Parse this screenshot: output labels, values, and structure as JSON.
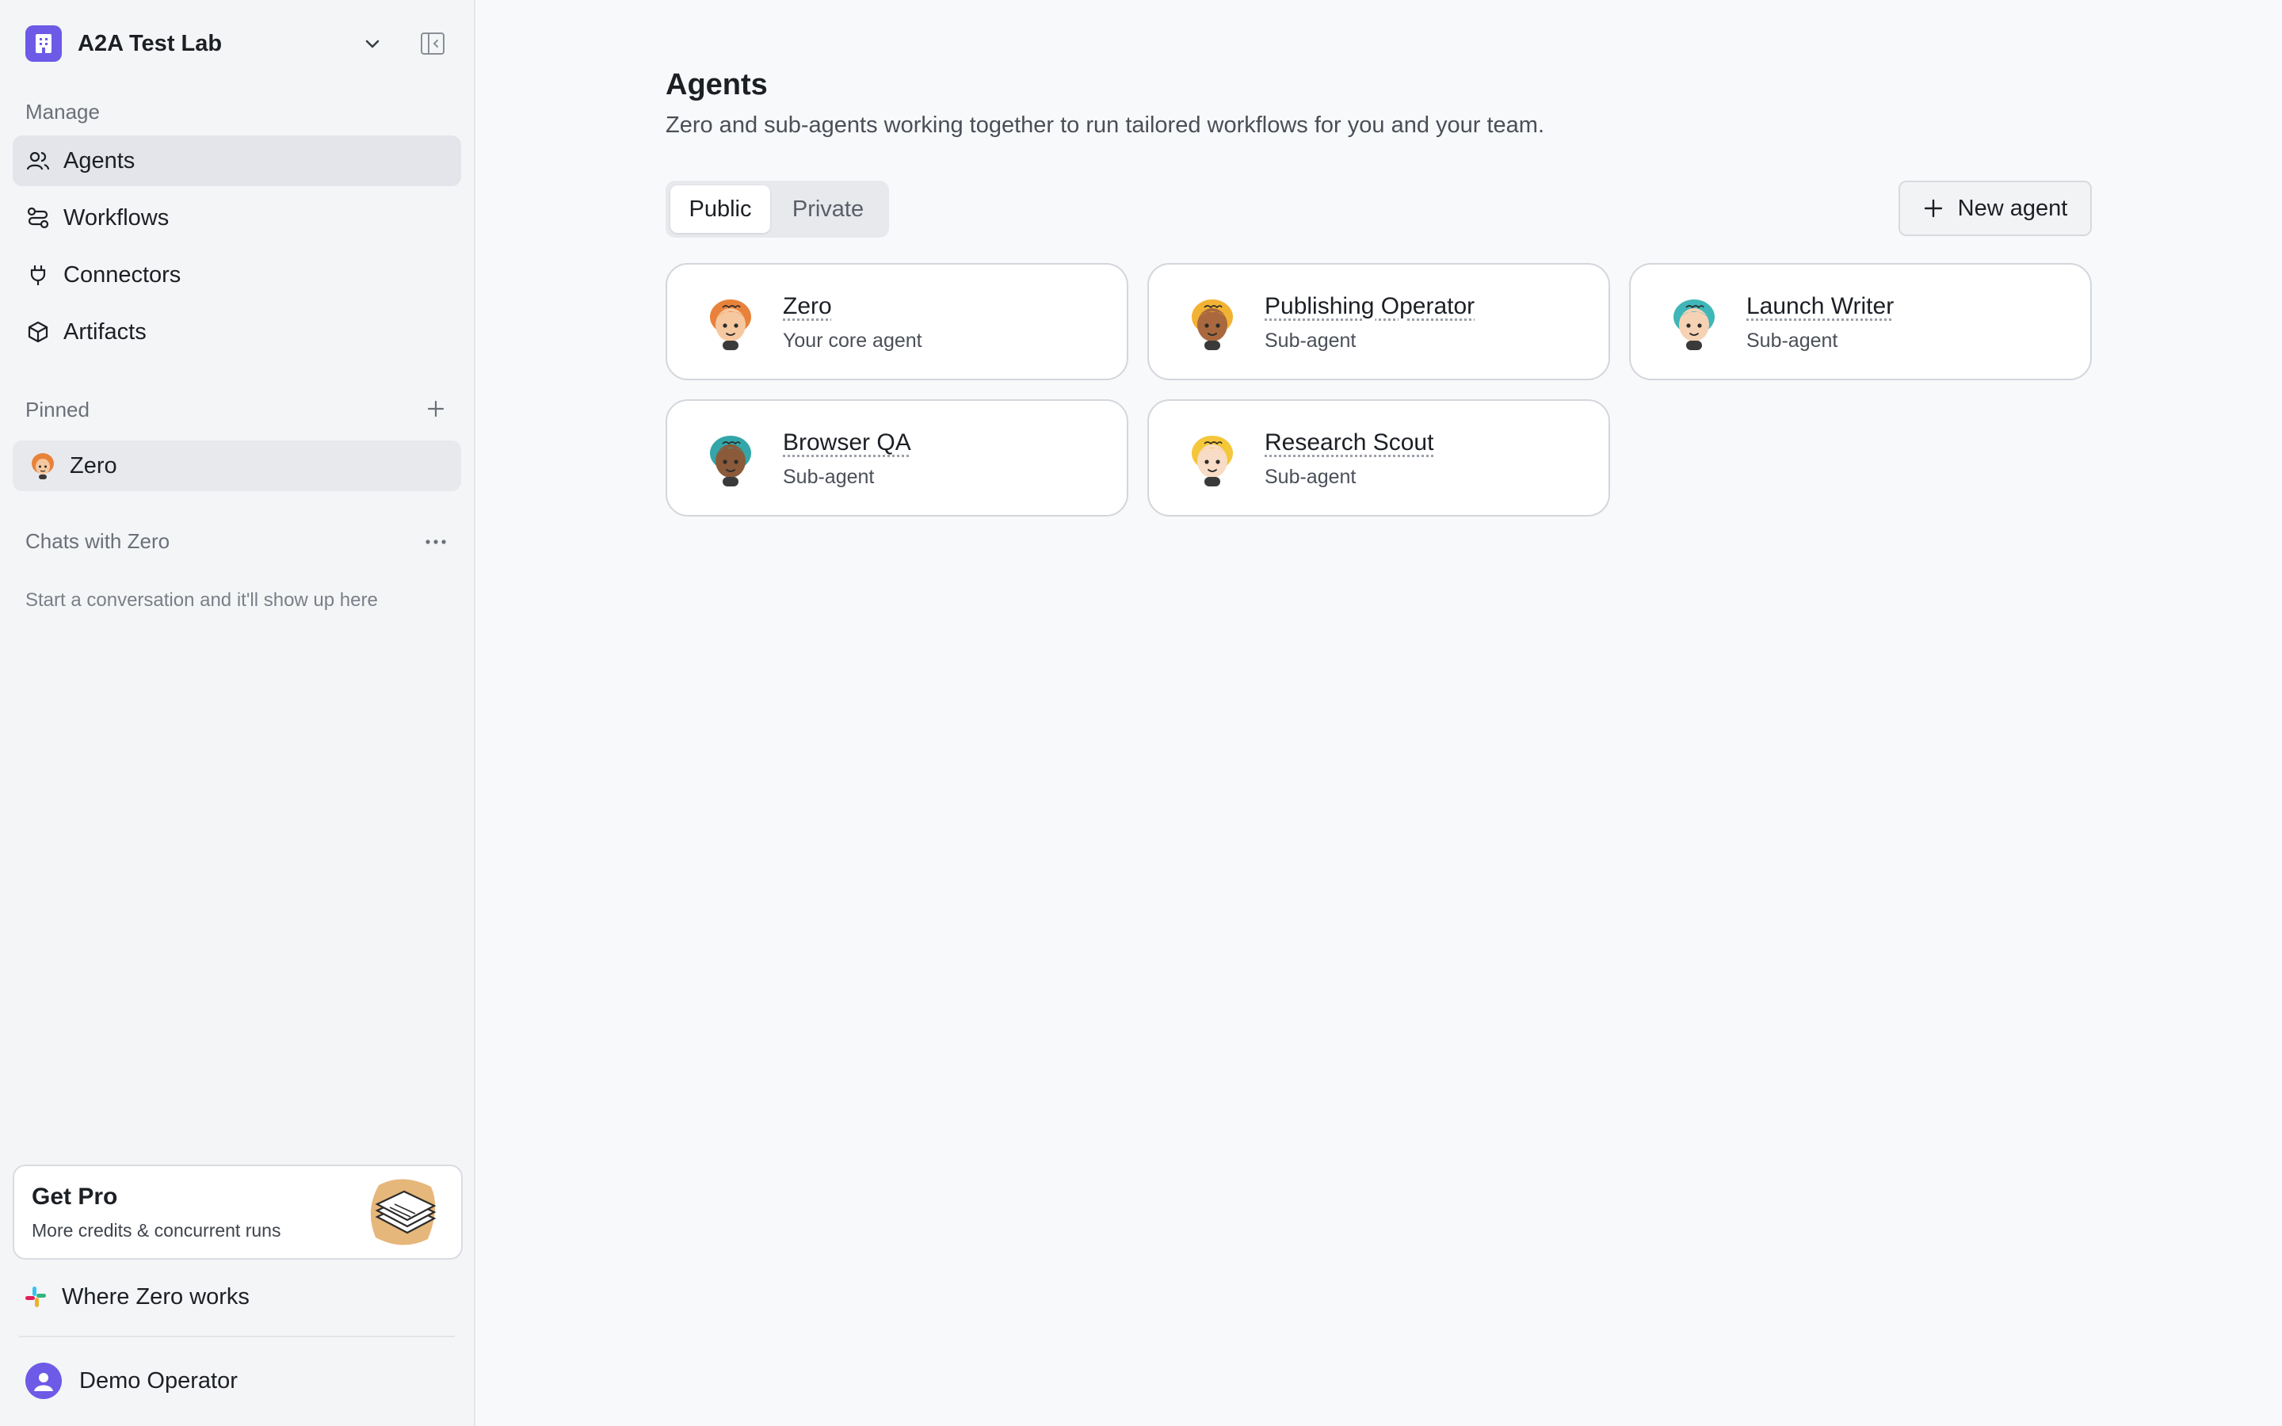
{
  "workspace": {
    "name": "A2A Test Lab"
  },
  "sidebar": {
    "manage_label": "Manage",
    "nav": [
      {
        "label": "Agents",
        "icon": "users-icon",
        "active": true
      },
      {
        "label": "Workflows",
        "icon": "workflow-icon",
        "active": false
      },
      {
        "label": "Connectors",
        "icon": "plug-icon",
        "active": false
      },
      {
        "label": "Artifacts",
        "icon": "box-icon",
        "active": false
      }
    ],
    "pinned_label": "Pinned",
    "pinned": [
      {
        "label": "Zero"
      }
    ],
    "chats_label": "Chats with Zero",
    "chats_empty": "Start a conversation and it'll show up here",
    "pro": {
      "title": "Get Pro",
      "subtitle": "More credits & concurrent runs"
    },
    "where_label": "Where Zero works",
    "user": {
      "name": "Demo Operator"
    }
  },
  "main": {
    "title": "Agents",
    "description": "Zero and sub-agents working together to run tailored workflows for you and your team.",
    "tabs": [
      {
        "label": "Public",
        "active": true
      },
      {
        "label": "Private",
        "active": false
      }
    ],
    "new_agent_label": "New agent",
    "agents": [
      {
        "name": "Zero",
        "role": "Your core agent",
        "hair": "#e8823a",
        "skin": "#f6c8a0"
      },
      {
        "name": "Publishing Operator",
        "role": "Sub-agent",
        "hair": "#f2b233",
        "skin": "#a9683e"
      },
      {
        "name": "Launch Writer",
        "role": "Sub-agent",
        "hair": "#3fb6b8",
        "skin": "#f6d2b4"
      },
      {
        "name": "Browser QA",
        "role": "Sub-agent",
        "hair": "#33a6a8",
        "skin": "#8a5a3a"
      },
      {
        "name": "Research Scout",
        "role": "Sub-agent",
        "hair": "#f4c63a",
        "skin": "#f8dcc6"
      }
    ]
  },
  "colors": {
    "accent": "#6d5ae6",
    "background": "#f8f9fb",
    "sidebar": "#f4f5f7"
  }
}
